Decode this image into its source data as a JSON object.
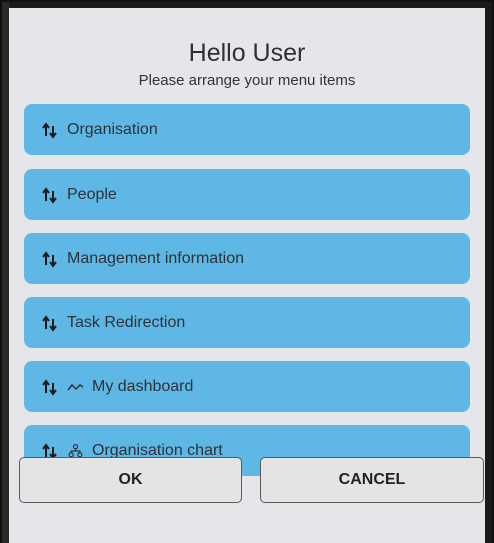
{
  "dialog": {
    "title": "Hello User",
    "subtitle": "Please arrange your menu items"
  },
  "menu_items": [
    {
      "label": "Organisation",
      "icon": "none"
    },
    {
      "label": "People",
      "icon": "none"
    },
    {
      "label": "Management information",
      "icon": "none"
    },
    {
      "label": "Task Redirection",
      "icon": "none"
    },
    {
      "label": "My dashboard",
      "icon": "trend-line-icon"
    },
    {
      "label": "Organisation chart",
      "icon": "org-chart-icon"
    }
  ],
  "buttons": {
    "ok": "OK",
    "cancel": "CANCEL"
  },
  "colors": {
    "item_background": "#5fb7e5",
    "dialog_background": "#e4e6ea",
    "button_background": "#e4e4e4"
  }
}
